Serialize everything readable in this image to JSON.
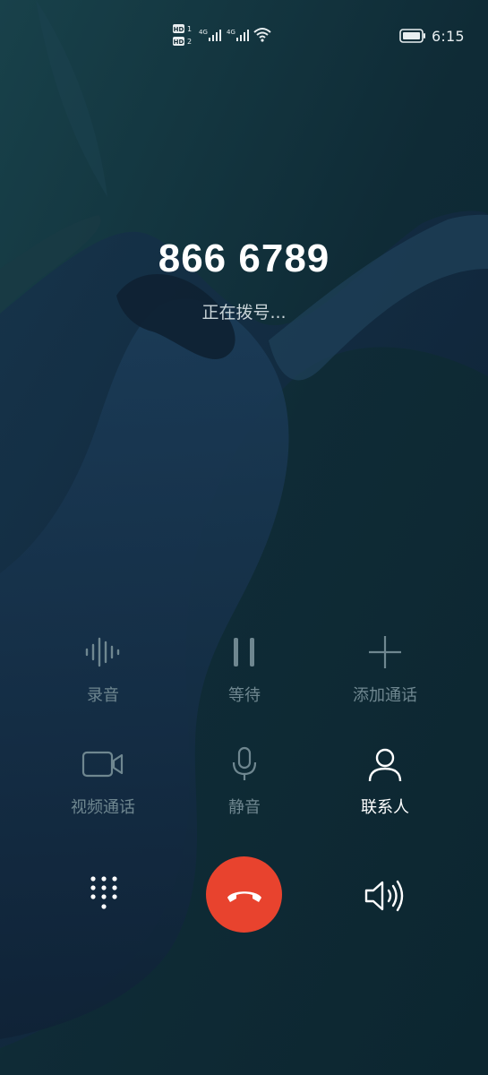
{
  "status_bar": {
    "time": "6:15",
    "network_labels": [
      "HD 1",
      "HD 2",
      "4G",
      "4G"
    ]
  },
  "call": {
    "number": "866 6789",
    "status": "正在拨号..."
  },
  "actions": [
    {
      "label": "录音",
      "icon": "waveform-record-icon",
      "enabled": false
    },
    {
      "label": "等待",
      "icon": "pause-icon",
      "enabled": false
    },
    {
      "label": "添加通话",
      "icon": "plus-icon",
      "enabled": false
    },
    {
      "label": "视频通话",
      "icon": "video-camera-icon",
      "enabled": false
    },
    {
      "label": "静音",
      "icon": "microphone-icon",
      "enabled": false
    },
    {
      "label": "联系人",
      "icon": "person-icon",
      "enabled": true
    }
  ],
  "bottom_controls": {
    "dialpad_icon": "dialpad-icon",
    "end_call_icon": "phone-hangup-icon",
    "speaker_icon": "speaker-icon",
    "end_call_color": "#e8432e"
  }
}
